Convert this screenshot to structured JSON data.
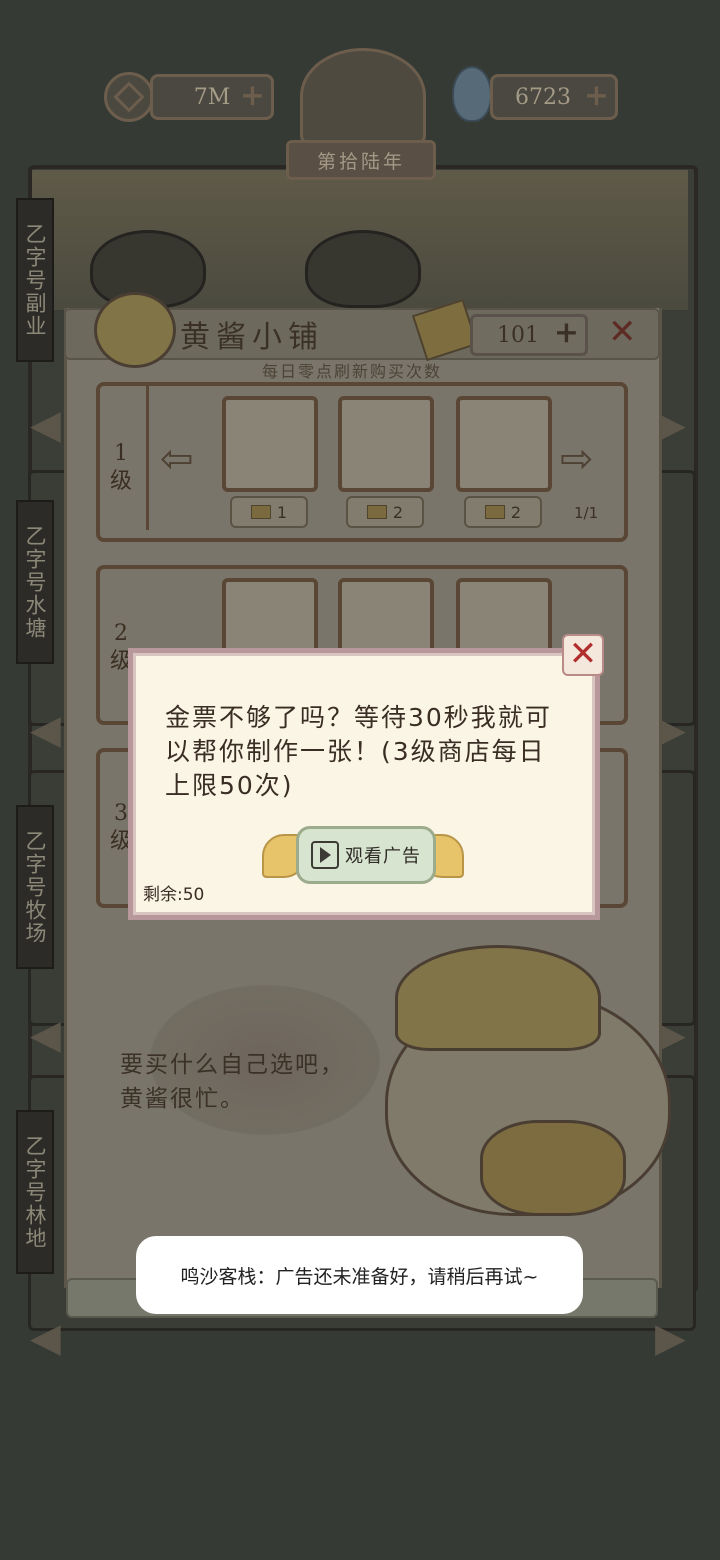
{
  "hud": {
    "coins": "7M",
    "spirit": "6723",
    "year": "第拾陆年"
  },
  "side_labels": [
    "乙字号副业",
    "乙字号水塘",
    "乙字号牧场",
    "乙字号林地"
  ],
  "shop": {
    "title": "黄酱小铺",
    "ticket_count": "101",
    "subtitle": "每日零点刷新购买次数",
    "tier1": {
      "label": "1级",
      "prices": [
        "1",
        "2",
        "2"
      ],
      "page": "1/1"
    },
    "tier2": {
      "label": "2级"
    },
    "tier3": {
      "label": "3级"
    }
  },
  "modal": {
    "message": "金票不够了吗？等待30秒我就可以帮你制作一张！(3级商店每日上限50次)",
    "button_label": "观看广告",
    "remaining": "剩余:50"
  },
  "speech": "要买什么自己选吧，黄酱很忙。",
  "toast": "鸣沙客栈：广告还未准备好，请稍后再试~"
}
